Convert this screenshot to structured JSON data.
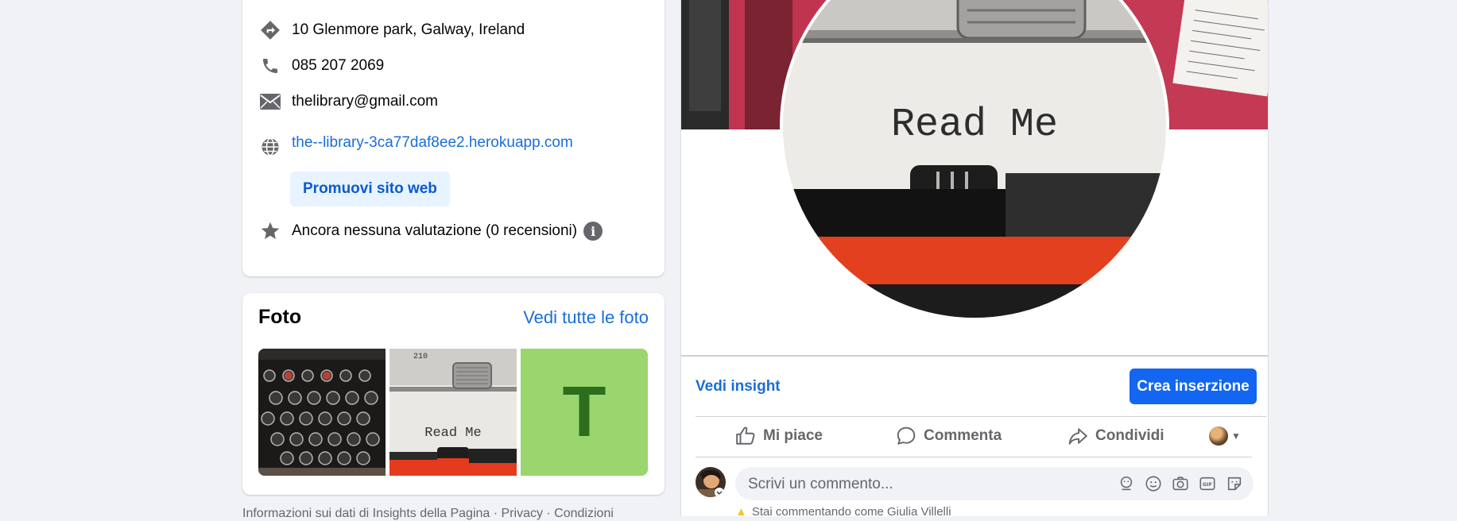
{
  "info": {
    "address": "10 Glenmore park, Galway, Ireland",
    "phone": "085 207 2069",
    "email": "thelibrary@gmail.com",
    "website": "the--library-3ca77daf8ee2.herokuapp.com",
    "promote_label": "Promuovi sito web",
    "rating": "Ancora nessuna valutazione (0 recensioni)",
    "info_glyph": "i"
  },
  "photos": {
    "title": "Foto",
    "see_all": "Vedi tutte le foto",
    "thumbs": [
      {
        "kind": "typewriter-keys"
      },
      {
        "kind": "read-me",
        "text": "Read Me"
      },
      {
        "kind": "letter",
        "text": "T",
        "bg": "#9ad56e",
        "fg": "#2c6e1b"
      }
    ]
  },
  "footer": "Informazioni sui dati di Insights della Pagina · Privacy · Condizioni",
  "profile": {
    "cover_text": "Read Me",
    "insight_link": "Vedi insight",
    "ad_button": "Crea inserzione"
  },
  "actions": {
    "like": "Mi piace",
    "comment": "Commenta",
    "share": "Condividi"
  },
  "comment": {
    "placeholder": "Scrivi un commento...",
    "warning": "Stai commentando come Giulia Villelli"
  },
  "colors": {
    "accent": "#1266f1",
    "link": "#1a6ed8",
    "page_bg": "#f0f2f5"
  }
}
